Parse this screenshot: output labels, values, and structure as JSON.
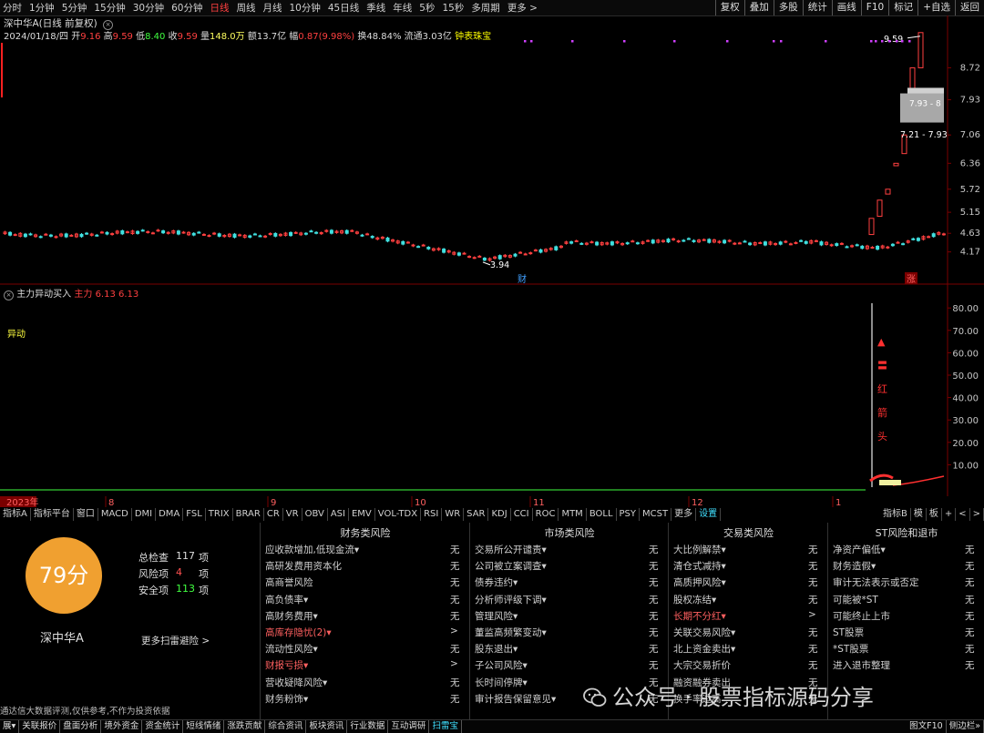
{
  "toolbar": {
    "periods": [
      "分时",
      "1分钟",
      "5分钟",
      "15分钟",
      "30分钟",
      "60分钟",
      "日线",
      "周线",
      "月线",
      "10分钟",
      "45日线",
      "季线",
      "年线",
      "5秒",
      "15秒",
      "多周期",
      "更多 >"
    ],
    "active_index": 6,
    "right_tools": [
      "复权",
      "叠加",
      "多股",
      "统计",
      "画线",
      "F10",
      "标记",
      "+自选",
      "返回"
    ]
  },
  "info": {
    "title": "深中华A(日线 前复权)",
    "date": "2024/01/18/四",
    "open_label": "开",
    "open": "9.16",
    "high_label": "高",
    "high": "9.59",
    "low_label": "低",
    "low": "8.40",
    "close_label": "收",
    "close": "9.59",
    "vol_label": "量",
    "vol": "148.0万",
    "amt_label": "额",
    "amt": "13.7亿",
    "chg_label": "幅",
    "chg": "0.87(9.98%)",
    "turn_label": "换",
    "turn": "48.84%",
    "float_label": "流通",
    "float": "3.03亿",
    "extra": "钟表珠宝"
  },
  "price_axis": {
    "ticks": [
      "8.72",
      "7.93",
      "7.06",
      "6.36",
      "5.72",
      "5.15",
      "4.63",
      "4.17"
    ],
    "min": 3.6,
    "max": 9.9
  },
  "price_labels": {
    "high": "9.59",
    "low": "3.94",
    "box1": "7.93 - 8",
    "box2": "7.21 - 7.93",
    "fin_mark": "财",
    "up_mark": "涨"
  },
  "colors": {
    "up": "#ff4040",
    "down": "#40e0e0",
    "grid": "#7a0000",
    "accent": "#f5a623",
    "warn": "#ff6060",
    "green": "#40ff40",
    "purple": "#d040ff"
  },
  "indicator": {
    "title": "主力异动买入",
    "label1": "主力",
    "vals": "6.13  6.13",
    "tag": "异动",
    "axis": [
      "80.00",
      "70.00",
      "60.00",
      "50.00",
      "40.00",
      "30.00",
      "20.00",
      "10.00"
    ],
    "vertical_text": [
      "▲",
      "〓",
      "红",
      "箭",
      "头"
    ]
  },
  "date_axis": {
    "labels": [
      "2023年",
      "8",
      "9",
      "10",
      "11",
      "12",
      "1"
    ],
    "right": "日线"
  },
  "tabs": [
    "指标A",
    "指标平台",
    "窗口",
    "MACD",
    "DMI",
    "DMA",
    "FSL",
    "TRIX",
    "BRAR",
    "CR",
    "VR",
    "OBV",
    "ASI",
    "EMV",
    "VOL-TDX",
    "RSI",
    "WR",
    "SAR",
    "KDJ",
    "CCI",
    "ROC",
    "MTM",
    "BOLL",
    "PSY",
    "MCST",
    "更多",
    "设置"
  ],
  "tabs_right": [
    "指标B",
    "模",
    "板",
    "+",
    "<",
    ">"
  ],
  "score": {
    "value": "79分",
    "stock": "深中华A",
    "rows": [
      {
        "label": "总检查",
        "num": "117",
        "unit": "项"
      },
      {
        "label": "风险项",
        "num": "4",
        "unit": "项"
      },
      {
        "label": "安全项",
        "num": "113",
        "unit": "项"
      }
    ],
    "more": "更多扫雷避险 >",
    "footer": "通达信大数据评测,仅供参考,不作为投资依据"
  },
  "risk_columns": [
    {
      "head": "财务类风险",
      "items": [
        {
          "label": "应收款增加,低现金流▾",
          "val": "无",
          "warn": false
        },
        {
          "label": "高研发费用资本化",
          "val": "无",
          "warn": false
        },
        {
          "label": "高商誉风险",
          "val": "无",
          "warn": false
        },
        {
          "label": "高负债率▾",
          "val": "无",
          "warn": false
        },
        {
          "label": "高财务费用▾",
          "val": "无",
          "warn": false
        },
        {
          "label": "高库存隐忧(2)▾",
          "val": ">",
          "warn": true
        },
        {
          "label": "流动性风险▾",
          "val": "无",
          "warn": false
        },
        {
          "label": "财报亏损▾",
          "val": ">",
          "warn": true
        },
        {
          "label": "营收疑降风险▾",
          "val": "无",
          "warn": false
        },
        {
          "label": "财务粉饰▾",
          "val": "无",
          "warn": false
        }
      ]
    },
    {
      "head": "市场类风险",
      "items": [
        {
          "label": "交易所公开谴责▾",
          "val": "无",
          "warn": false
        },
        {
          "label": "公司被立案调查▾",
          "val": "无",
          "warn": false
        },
        {
          "label": "债券违约▾",
          "val": "无",
          "warn": false
        },
        {
          "label": "分析师评级下调▾",
          "val": "无",
          "warn": false
        },
        {
          "label": "管理风险▾",
          "val": "无",
          "warn": false
        },
        {
          "label": "董监高频繁变动▾",
          "val": "无",
          "warn": false
        },
        {
          "label": "股东退出▾",
          "val": "无",
          "warn": false
        },
        {
          "label": "子公司风险▾",
          "val": "无",
          "warn": false
        },
        {
          "label": "长时间停牌▾",
          "val": "无",
          "warn": false
        },
        {
          "label": "审计报告保留意见▾",
          "val": "无",
          "warn": false
        }
      ]
    },
    {
      "head": "交易类风险",
      "items": [
        {
          "label": "大比例解禁▾",
          "val": "无",
          "warn": false
        },
        {
          "label": "清仓式减持▾",
          "val": "无",
          "warn": false
        },
        {
          "label": "高质押风险▾",
          "val": "无",
          "warn": false
        },
        {
          "label": "股权冻结▾",
          "val": "无",
          "warn": false
        },
        {
          "label": "长期不分红▾",
          "val": ">",
          "warn": true
        },
        {
          "label": "关联交易风险▾",
          "val": "无",
          "warn": false
        },
        {
          "label": "北上资金卖出▾",
          "val": "无",
          "warn": false
        },
        {
          "label": "大宗交易折价",
          "val": "无",
          "warn": false
        },
        {
          "label": "融资融券卖出",
          "val": "无",
          "warn": false
        },
        {
          "label": "换手率过高",
          "val": "无",
          "warn": false
        }
      ]
    },
    {
      "head": "ST风险和退市",
      "items": [
        {
          "label": "净资产偏低▾",
          "val": "无",
          "warn": false
        },
        {
          "label": "财务造假▾",
          "val": "无",
          "warn": false
        },
        {
          "label": "审计无法表示或否定",
          "val": "无",
          "warn": false
        },
        {
          "label": "可能被*ST",
          "val": "无",
          "warn": false
        },
        {
          "label": "可能终止上市",
          "val": "无",
          "warn": false
        },
        {
          "label": "ST股票",
          "val": "无",
          "warn": false
        },
        {
          "label": "*ST股票",
          "val": "无",
          "warn": false
        },
        {
          "label": "进入退市整理",
          "val": "无",
          "warn": false
        }
      ]
    }
  ],
  "bottom_tabs": [
    "展▾",
    "关联报价",
    "盘面分析",
    "境外资金",
    "资金统计",
    "短线情绪",
    "涨跌贡献",
    "综合资讯",
    "板块资讯",
    "行业数据",
    "互动调研",
    "扫雷宝"
  ],
  "bottom_right": [
    "图文F10",
    "侧边栏»"
  ],
  "watermark": "公众号 · 股票指标源码分享"
}
